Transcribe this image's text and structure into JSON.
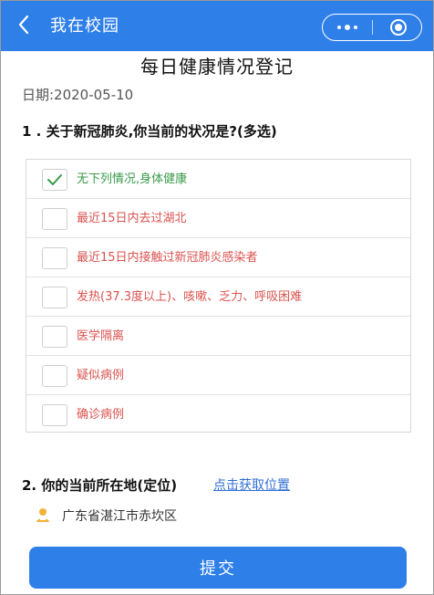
{
  "app": {
    "back_icon": "chevron-left-icon",
    "title": "我在校园",
    "capsule": {
      "more_icon": "more-dots-icon",
      "close_icon": "target-icon"
    },
    "theme_color": "#2f7fe8"
  },
  "form": {
    "title": "每日健康情况登记",
    "date": "日期:2020-05-10",
    "question1": "1 . 关于新冠肺炎,你当前的状况是?(多选)",
    "options": [
      {
        "label": "无下列情况,身体健康",
        "checked": true
      },
      {
        "label": "最近15日内去过湖北",
        "checked": false
      },
      {
        "label": "最近15日内接触过新冠肺炎感染者",
        "checked": false
      },
      {
        "label": "发热(37.3度以上)、咳嗽、乏力、呼吸困难",
        "checked": false
      },
      {
        "label": "医学隔离",
        "checked": false
      },
      {
        "label": "疑似病例",
        "checked": false
      },
      {
        "label": "确诊病例",
        "checked": false
      }
    ],
    "question2": "2. 你的当前所在地(定位)",
    "location_link": "点击获取位置",
    "location_icon": "location-person-icon",
    "address": "广东省湛江市赤坎区",
    "submit_label": "提交",
    "colors": {
      "checked_text": "#3a9a4a",
      "unchecked_text": "#d9534f",
      "link": "#2f6fd6"
    }
  }
}
